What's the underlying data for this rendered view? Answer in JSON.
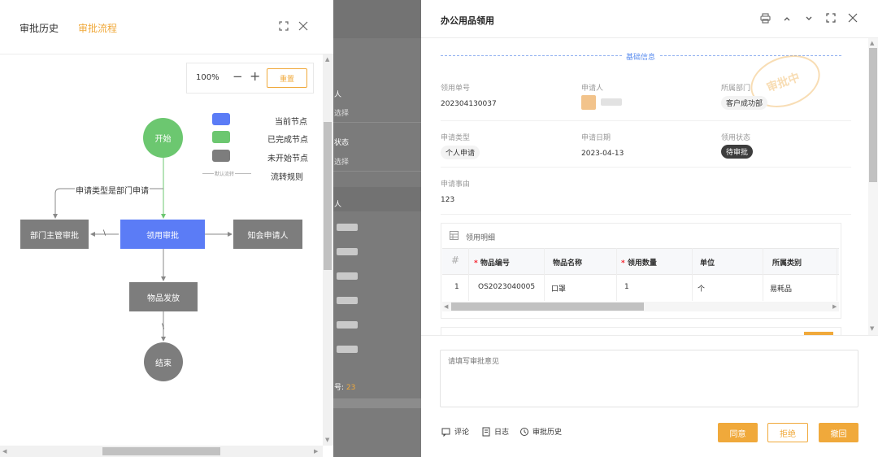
{
  "left_panel": {
    "tabs": [
      {
        "label": "审批历史"
      },
      {
        "label": "审批流程"
      }
    ],
    "zoom": "100%",
    "zoom_out": "−",
    "zoom_in": "+",
    "reset_label": "重置",
    "legend": [
      {
        "label": "当前节点",
        "color": "#5b7cf6"
      },
      {
        "label": "已完成节点",
        "color": "#6cc770"
      },
      {
        "label": "未开始节点",
        "color": "#7d7d7d"
      },
      {
        "label": "流转规则",
        "line_text": "默认流转"
      }
    ],
    "flow": {
      "start": "开始",
      "condition": "申请类型是部门申请",
      "node_dept": "部门主管审批",
      "node_current": "领用审批",
      "node_notify": "知会申请人",
      "node_issue": "物品发放",
      "end": "结束",
      "slash1": "\\",
      "slash2": "\\"
    }
  },
  "background": {
    "labels": [
      "人",
      "选择",
      "状态",
      "选择",
      "人"
    ],
    "footer_text": "号: ",
    "footer_num": "23"
  },
  "right_panel": {
    "title": "办公用品领用",
    "section": "基础信息",
    "stamp": "审批中",
    "fields": {
      "req_no_label": "领用单号",
      "req_no": "202304130037",
      "applicant_label": "申请人",
      "dept_label": "所属部门",
      "dept": "客户成功部",
      "type_label": "申请类型",
      "type": "个人申请",
      "date_label": "申请日期",
      "date": "2023-04-13",
      "status_label": "领用状态",
      "status": "待审批",
      "reason_label": "申请事由",
      "reason": "123"
    },
    "detail": {
      "title": "领用明细",
      "columns": [
        "#",
        "物品编号",
        "物品名称",
        "领用数量",
        "单位",
        "所属类别"
      ],
      "rows": [
        {
          "no": "1",
          "code": "OS2023040005",
          "name": "口罩",
          "qty": "1",
          "unit": "个",
          "category": "易耗品"
        }
      ]
    },
    "opinion_placeholder": "请填写审批意见",
    "footer_links": [
      {
        "label": "评论"
      },
      {
        "label": "日志"
      },
      {
        "label": "审批历史"
      }
    ],
    "buttons": {
      "approve": "同意",
      "reject": "拒绝",
      "withdraw": "撤回"
    }
  },
  "colors": {
    "accent": "#f0a93b",
    "current_node": "#5b7cf6",
    "done_node": "#6cc770",
    "todo_node": "#7d7d7d",
    "link_blue": "#5b8def"
  }
}
